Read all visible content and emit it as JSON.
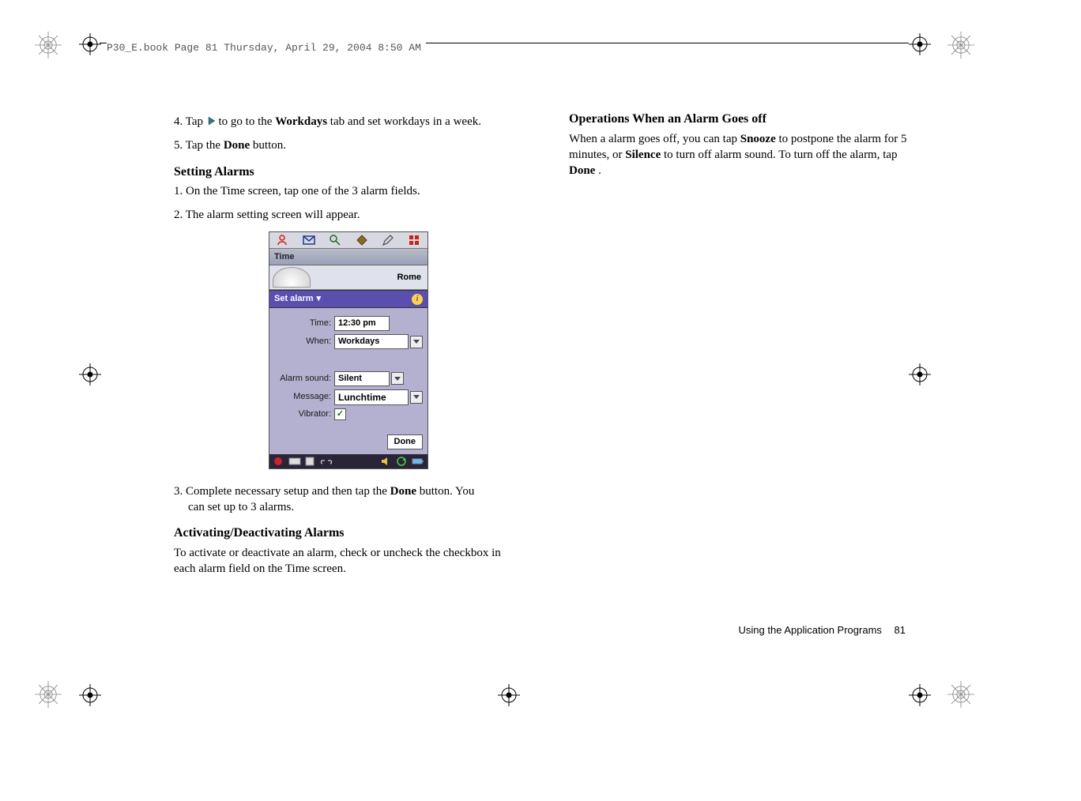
{
  "banner": "P30_E.book  Page 81  Thursday, April 29, 2004  8:50 AM",
  "left": {
    "step4_pre": "4. Tap ",
    "step4_post": " to go to the ",
    "step4_bold": "Workdays",
    "step4_tail": " tab and set workdays in a week.",
    "step5_pre": "5. Tap the ",
    "step5_bold": "Done",
    "step5_tail": " button.",
    "h_setting": "Setting Alarms",
    "set1": "1. On the Time screen, tap one of the 3 alarm fields.",
    "set2": "2. The alarm setting screen will appear.",
    "set3_pre": "3. Complete necessary setup and then tap the ",
    "set3_bold": "Done",
    "set3_mid": " button. You",
    "set3_sub": "can set up to 3 alarms.",
    "h_activate": "Activating/Deactivating Alarms",
    "activate_body": "To activate or deactivate an alarm, check or uncheck the checkbox in each alarm field on the Time screen."
  },
  "right": {
    "h_ops": "Operations When an Alarm Goes off",
    "ops_pre": "When a alarm goes off, you can tap ",
    "ops_b1": "Snooze",
    "ops_mid1": " to postpone the alarm for 5 minutes, or ",
    "ops_b2": "Silence",
    "ops_mid2": " to turn off alarm sound. To turn off the alarm, tap ",
    "ops_b3": "Done",
    "ops_tail": "."
  },
  "phone": {
    "title": "Time",
    "city": "Rome",
    "set_alarm": "Set alarm",
    "labels": {
      "time": "Time:",
      "when": "When:",
      "sound": "Alarm sound:",
      "message": "Message:",
      "vibrator": "Vibrator:"
    },
    "values": {
      "time": "12:30 pm",
      "when": "Workdays",
      "sound": "Silent",
      "message": "Lunchtime"
    },
    "done": "Done"
  },
  "footer": {
    "section": "Using the Application Programs",
    "page": "81"
  }
}
